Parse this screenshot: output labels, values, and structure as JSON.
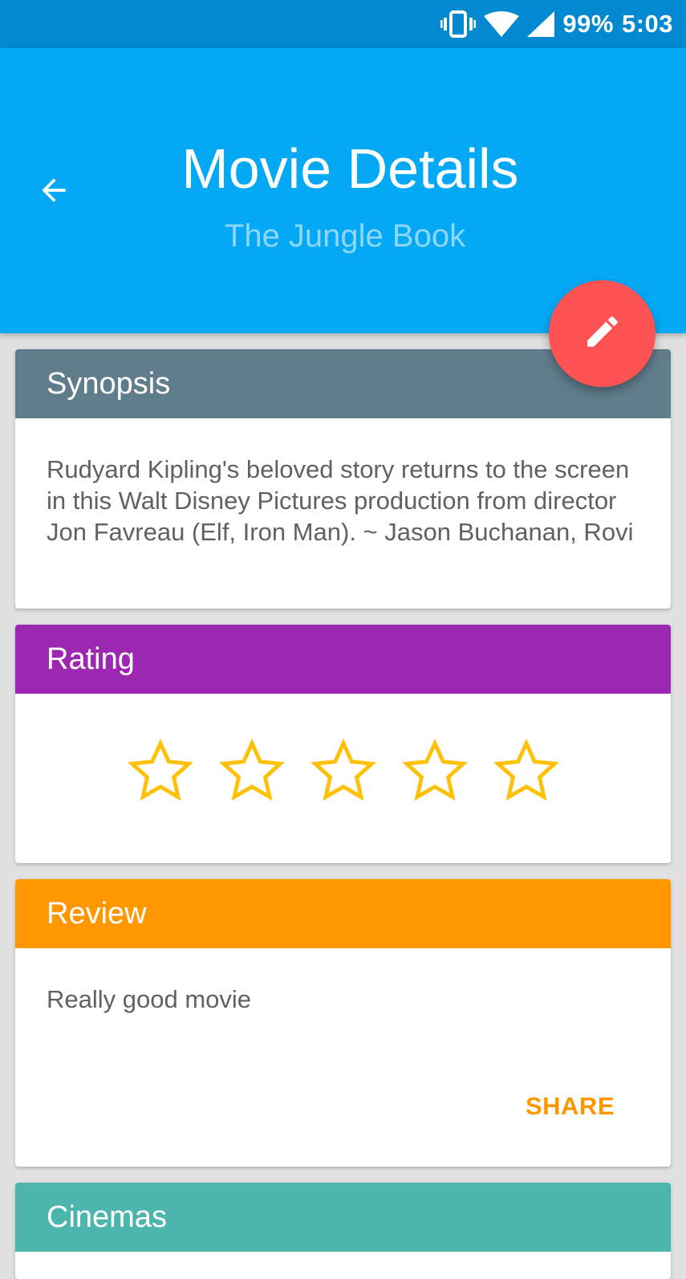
{
  "status_bar": {
    "battery": "99%",
    "time": "5:03",
    "icons": [
      "vibrate-icon",
      "wifi-icon",
      "signal-icon"
    ]
  },
  "app_bar": {
    "title": "Movie Details",
    "subtitle": "The Jungle Book",
    "back_icon": "arrow-back-icon",
    "background": "#03a9f4"
  },
  "fab": {
    "icon": "edit-pencil-icon",
    "color": "#ff5252"
  },
  "synopsis": {
    "header": "Synopsis",
    "text": "Rudyard Kipling's beloved story returns to the screen in this Walt Disney Pictures production from director Jon Favreau (Elf, Iron Man). ~ Jason Buchanan, Rovi",
    "color": "#607d8b"
  },
  "rating": {
    "header": "Rating",
    "value": 0,
    "max": 5,
    "color": "#9c27b0",
    "star_color": "#ffc107"
  },
  "review": {
    "header": "Review",
    "text": "Really good movie",
    "share_label": "SHARE",
    "color": "#ff9800"
  },
  "cinemas": {
    "header": "Cinemas",
    "color": "#4db6ac"
  }
}
